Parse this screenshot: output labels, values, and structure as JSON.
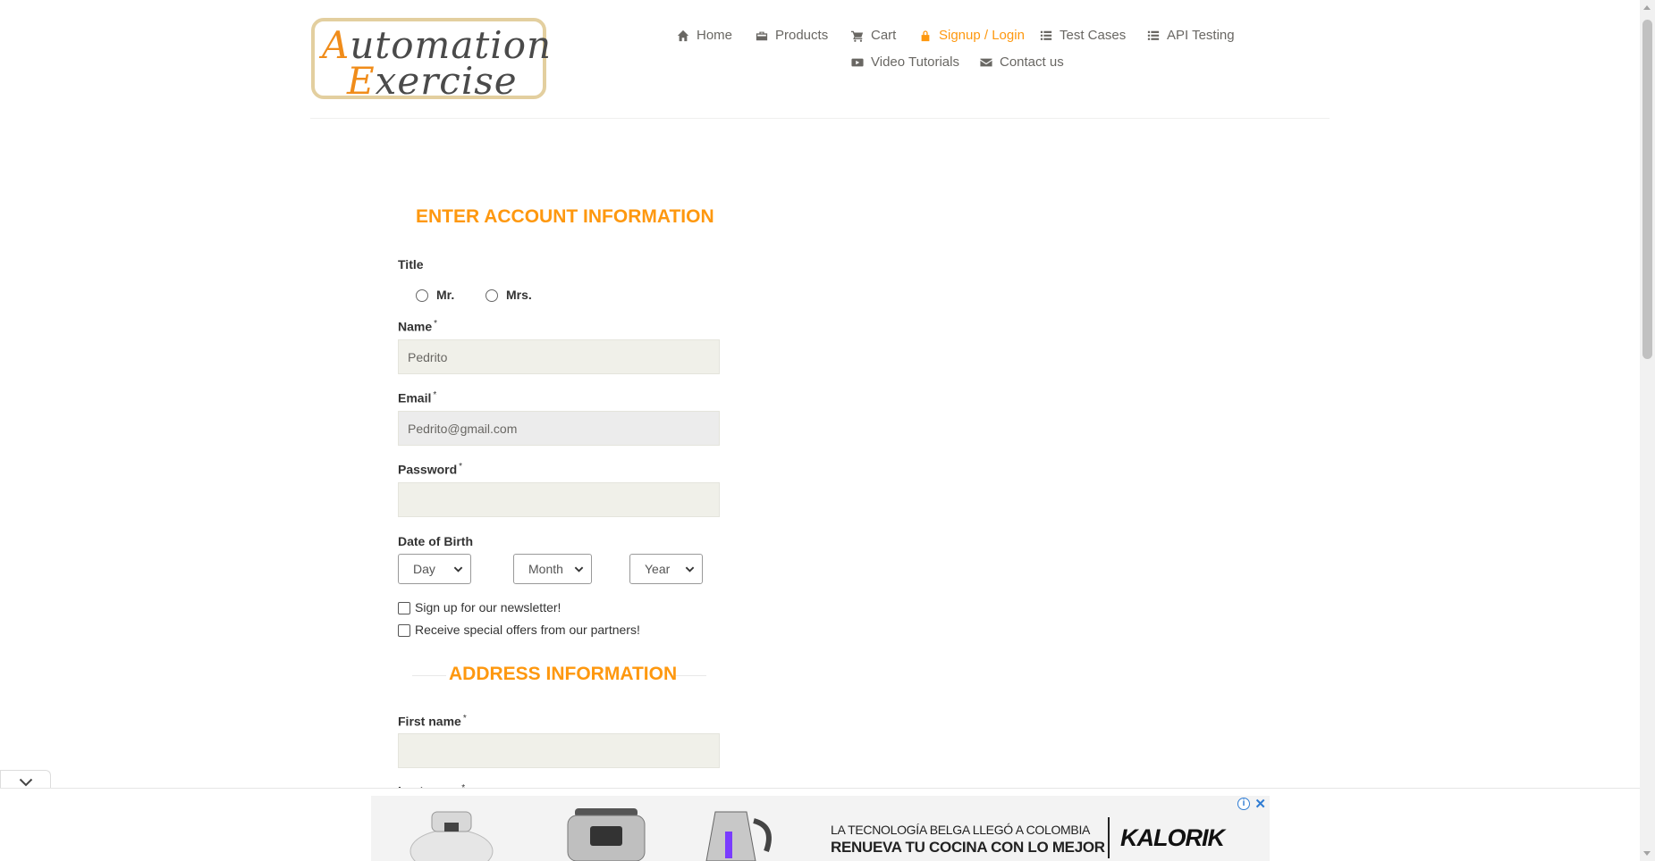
{
  "logo": {
    "line1_cap": "A",
    "line1_rest": "utomation",
    "line2_cap": "E",
    "line2_rest": "xercise"
  },
  "nav": {
    "home": "Home",
    "products": "Products",
    "cart": "Cart",
    "signup_login": "Signup / Login",
    "test_cases": "Test Cases",
    "api_testing": "API Testing",
    "video_tutorials": "Video Tutorials",
    "contact_us": "Contact us"
  },
  "form": {
    "title": "ENTER ACCOUNT INFORMATION",
    "title_label": "Title",
    "mr": "Mr.",
    "mrs": "Mrs.",
    "name_label": "Name",
    "name_value": "Pedrito",
    "email_label": "Email",
    "email_value": "Pedrito@gmail.com",
    "password_label": "Password",
    "password_value": "",
    "required_mark": "*",
    "dob_label": "Date of Birth",
    "day": "Day",
    "month": "Month",
    "year": "Year",
    "newsletter": "Sign up for our newsletter!",
    "offers": "Receive special offers from our partners!"
  },
  "address": {
    "title": "ADDRESS INFORMATION",
    "first_name_label": "First name",
    "first_name_value": "",
    "last_name_label": "Last name"
  },
  "ad": {
    "line1": "LA TECNOLOGÍA BELGA LLEGÓ A COLOMBIA",
    "line2": "RENUEVA TU COCINA CON LO MEJOR",
    "brand": "KALORIK",
    "info": "i",
    "close": "✕"
  },
  "colors": {
    "accent": "#fe980f",
    "nav_text": "#696763",
    "field_bg": "#f0f0e9"
  }
}
